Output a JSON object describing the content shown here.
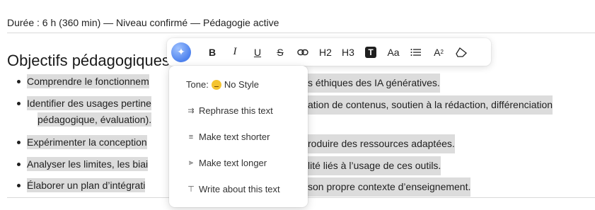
{
  "meta_line": "Durée : 6 h (360 min) — Niveau confirmé — Pédagogie active",
  "section": {
    "heading": "Objectifs pédagogiques"
  },
  "objectives": [
    {
      "text": "Comprendre le fonctionnement [...] éthiques des IA génératives.",
      "line1_left": "Comprendre le fonctionnem",
      "line1_right": "s éthiques des IA génératives."
    },
    {
      "line1_left": "Identifier des usages pertine",
      "line1_right": "ation de contenus, soutien à la rédaction, différenciation",
      "line2": "pédagogique, évaluation)."
    },
    {
      "line1_left": "Expérimenter la conception",
      "line1_right": "roduire des ressources adaptées."
    },
    {
      "line1_left": "Analyser les limites, les biai",
      "line1_right": "lité liés à l’usage de ces outils."
    },
    {
      "line1_left": "Élaborer un plan d’intégrati",
      "line1_right": "son propre contexte d’enseignement."
    }
  ],
  "toolbar": {
    "ai_icon": "sparkle-icon",
    "bold": "B",
    "italic": "I",
    "underline": "U",
    "strike": "S",
    "h2": "H2",
    "h3": "H3",
    "text_box": "T",
    "font_size": "Aa",
    "superscript_base": "A",
    "superscript_exp": "2"
  },
  "ai_menu": {
    "tone_label": "Tone:",
    "tone_value": "No Style",
    "items": [
      {
        "label": "Rephrase this text",
        "icon": "rephrase-icon"
      },
      {
        "label": "Make text shorter",
        "icon": "shorter-icon"
      },
      {
        "label": "Make text longer",
        "icon": "longer-icon"
      },
      {
        "label": "Write about this text",
        "icon": "write-about-icon"
      }
    ]
  }
}
